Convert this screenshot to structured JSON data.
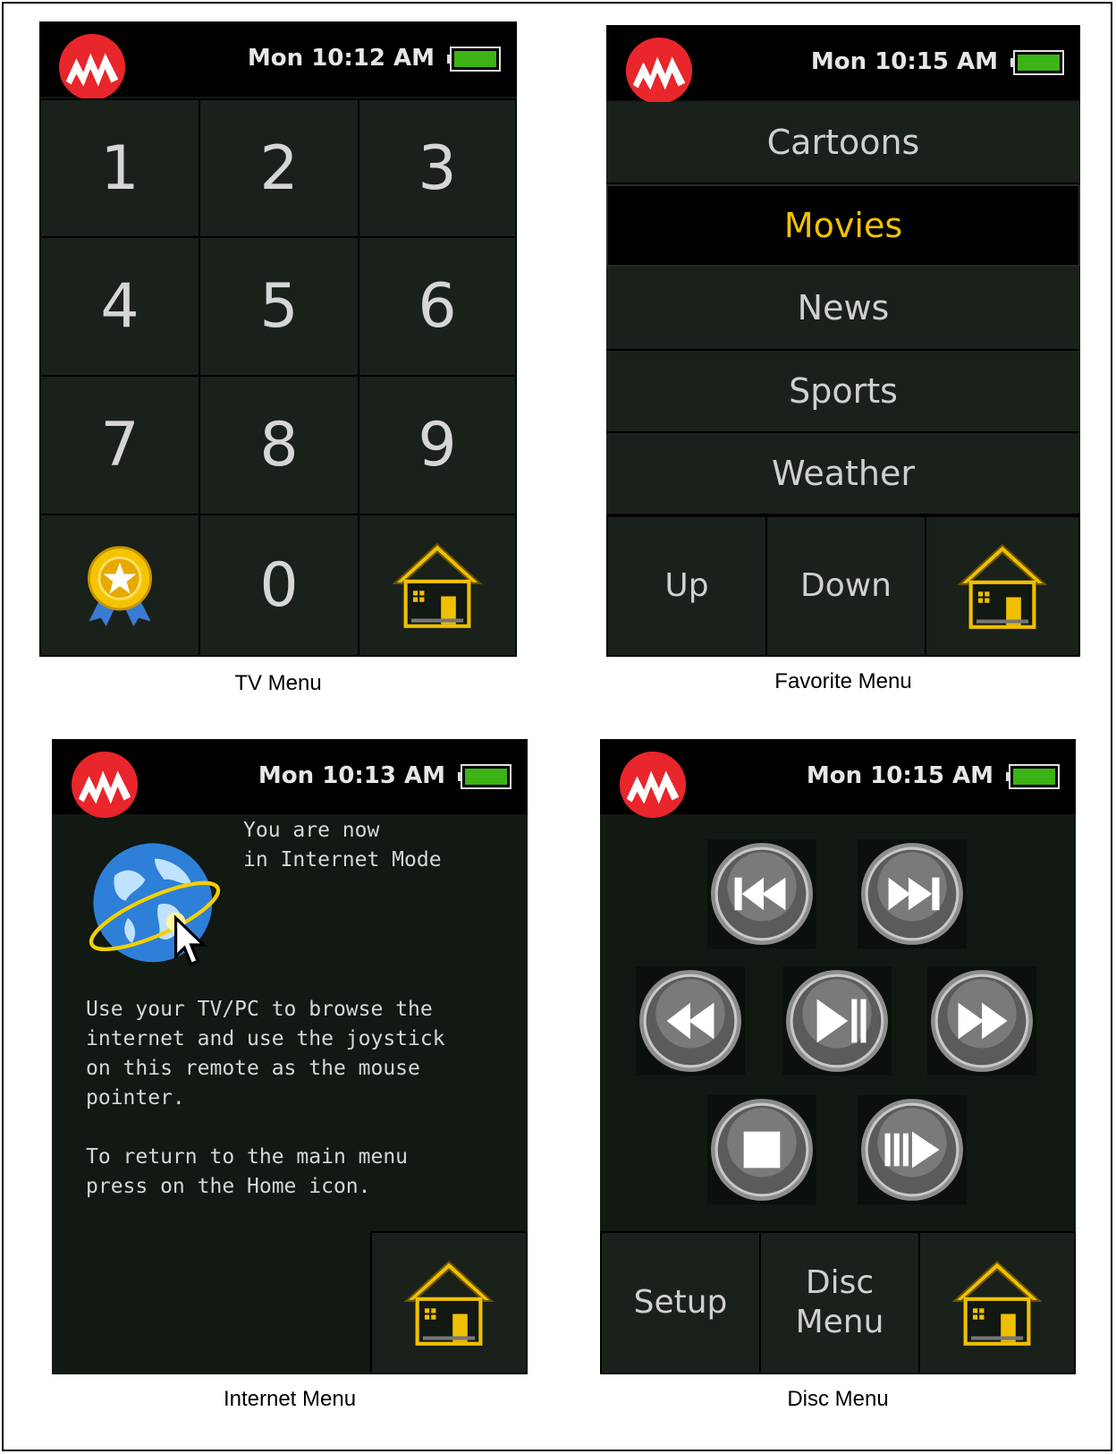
{
  "tv_menu": {
    "caption": "TV Menu",
    "status": {
      "time": "Mon 10:12 AM"
    },
    "keys": [
      "1",
      "2",
      "3",
      "4",
      "5",
      "6",
      "7",
      "8",
      "9",
      "0"
    ],
    "icons": {
      "favorite": "award-ribbon-icon",
      "home": "home-icon"
    }
  },
  "favorite_menu": {
    "caption": "Favorite Menu",
    "status": {
      "time": "Mon 10:15 AM"
    },
    "items": [
      {
        "label": "Cartoons",
        "selected": false
      },
      {
        "label": "Movies",
        "selected": true
      },
      {
        "label": "News",
        "selected": false
      },
      {
        "label": "Sports",
        "selected": false
      },
      {
        "label": "Weather",
        "selected": false
      }
    ],
    "buttons": {
      "up": "Up",
      "down": "Down"
    }
  },
  "internet_menu": {
    "caption": "Internet Menu",
    "status": {
      "time": "Mon 10:13 AM"
    },
    "mode_text": "You are now\nin Internet Mode",
    "instructions": "Use your TV/PC to browse the\ninternet and use the joystick\non this remote as the mouse\npointer.\n\nTo return to the main menu\npress on the Home icon.",
    "icons": {
      "globe": "globe-cursor-icon"
    }
  },
  "disc_menu": {
    "caption": "Disc Menu",
    "status": {
      "time": "Mon 10:15 AM"
    },
    "buttons": {
      "setup": "Setup",
      "disc_menu_line1": "Disc",
      "disc_menu_line2": "Menu"
    },
    "media_icons": [
      "skip-back-icon",
      "skip-forward-icon",
      "rewind-icon",
      "play-pause-icon",
      "fast-forward-icon",
      "stop-icon",
      "slow-play-icon"
    ]
  },
  "colors": {
    "screen_bg": "#1a211a",
    "selected_text": "#f2c200",
    "battery": "#3cb316",
    "logo": "#e8262b",
    "home": "#f0c000"
  }
}
